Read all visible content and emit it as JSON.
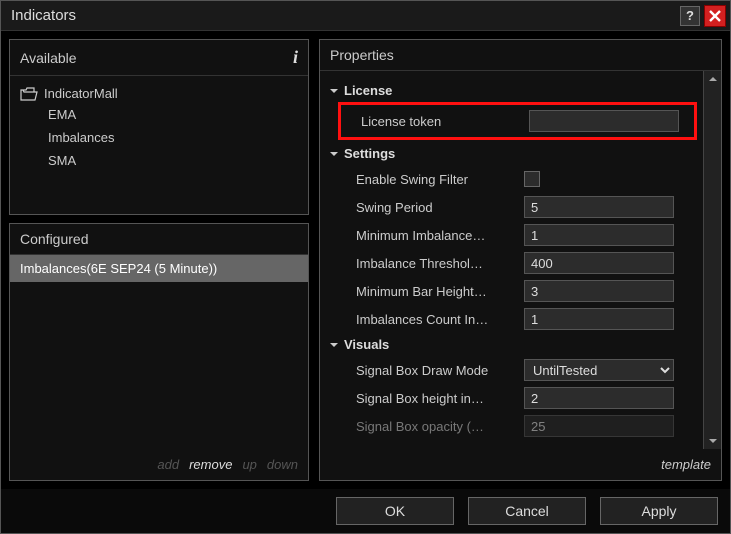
{
  "dialog": {
    "title": "Indicators"
  },
  "available": {
    "header": "Available",
    "folder": "IndicatorMall",
    "items": [
      "EMA",
      "Imbalances",
      "SMA"
    ]
  },
  "configured": {
    "header": "Configured",
    "items": [
      "Imbalances(6E SEP24 (5 Minute))"
    ],
    "actions": {
      "add": "add",
      "remove": "remove",
      "up": "up",
      "down": "down"
    }
  },
  "properties": {
    "header": "Properties",
    "groups": {
      "license": {
        "label": "License",
        "token_label": "License token",
        "token_value": ""
      },
      "settings": {
        "label": "Settings",
        "rows": [
          {
            "label": "Enable Swing Filter",
            "type": "checkbox",
            "value": false
          },
          {
            "label": "Swing Period",
            "type": "text",
            "value": "5"
          },
          {
            "label": "Minimum Imbalance…",
            "type": "text",
            "value": "1"
          },
          {
            "label": "Imbalance Threshol…",
            "type": "text",
            "value": "400"
          },
          {
            "label": "Minimum Bar Height…",
            "type": "text",
            "value": "3"
          },
          {
            "label": "Imbalances Count In…",
            "type": "text",
            "value": "1"
          }
        ]
      },
      "visuals": {
        "label": "Visuals",
        "rows": [
          {
            "label": "Signal Box Draw Mode",
            "type": "select",
            "value": "UntilTested"
          },
          {
            "label": "Signal Box height in…",
            "type": "text",
            "value": "2"
          },
          {
            "label": "Signal Box opacity (…",
            "type": "text",
            "value": "25"
          }
        ]
      }
    },
    "template_link": "template"
  },
  "buttons": {
    "ok": "OK",
    "cancel": "Cancel",
    "apply": "Apply"
  }
}
